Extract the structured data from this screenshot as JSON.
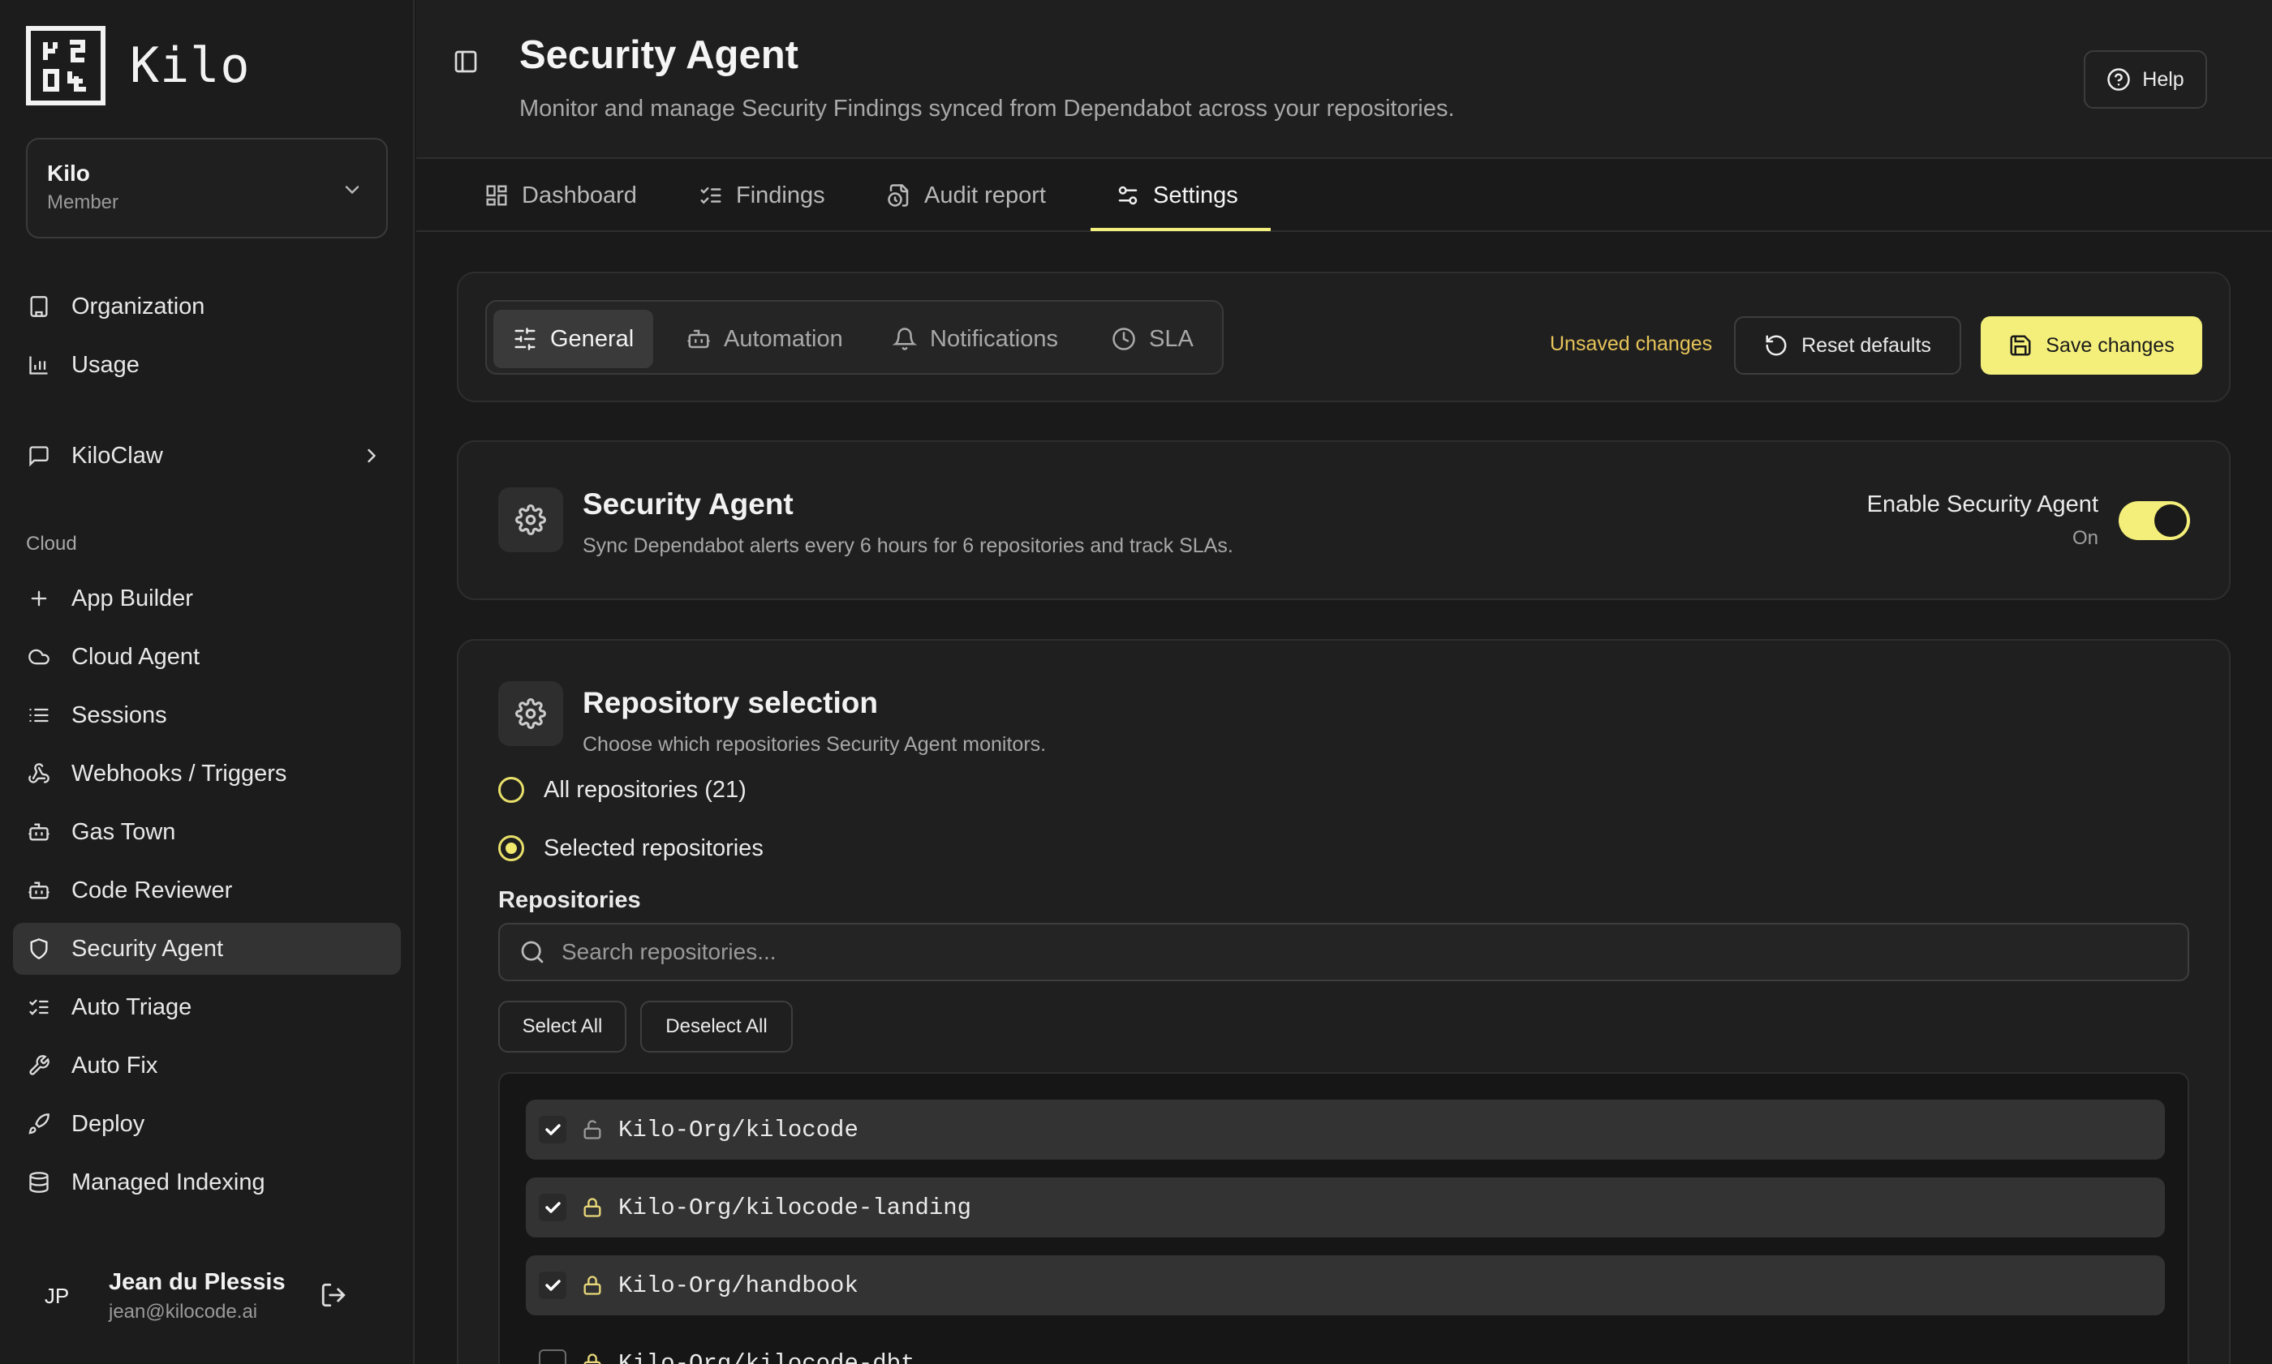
{
  "app": {
    "name": "Kilo"
  },
  "org_switcher": {
    "name": "Kilo",
    "role": "Member"
  },
  "nav": {
    "top_items": [
      {
        "label": "Organization",
        "icon": "building-icon"
      },
      {
        "label": "Usage",
        "icon": "bar-chart-icon"
      }
    ],
    "kiloclaw": {
      "label": "KiloClaw",
      "icon": "message-square-icon"
    },
    "section_label": "Cloud",
    "cloud_items": [
      {
        "label": "App Builder",
        "icon": "plus-icon"
      },
      {
        "label": "Cloud Agent",
        "icon": "cloud-icon"
      },
      {
        "label": "Sessions",
        "icon": "list-icon"
      },
      {
        "label": "Webhooks / Triggers",
        "icon": "webhook-icon"
      },
      {
        "label": "Gas Town",
        "icon": "bot-icon"
      },
      {
        "label": "Code Reviewer",
        "icon": "bot-icon"
      },
      {
        "label": "Security Agent",
        "icon": "shield-icon",
        "active": true
      },
      {
        "label": "Auto Triage",
        "icon": "list-checks-icon"
      },
      {
        "label": "Auto Fix",
        "icon": "wrench-icon"
      },
      {
        "label": "Deploy",
        "icon": "rocket-icon"
      },
      {
        "label": "Managed Indexing",
        "icon": "database-icon"
      }
    ]
  },
  "user": {
    "initials": "JP",
    "name": "Jean du Plessis",
    "email": "jean@kilocode.ai"
  },
  "header": {
    "title": "Security Agent",
    "subtitle": "Monitor and manage Security Findings synced from Dependabot across your repositories.",
    "help_label": "Help"
  },
  "tabs": [
    {
      "label": "Dashboard",
      "icon": "dashboard-icon"
    },
    {
      "label": "Findings",
      "icon": "list-checks-icon"
    },
    {
      "label": "Audit report",
      "icon": "file-clock-icon"
    },
    {
      "label": "Settings",
      "icon": "settings-sliders-icon",
      "active": true
    }
  ],
  "settings": {
    "subtabs": [
      {
        "label": "General",
        "icon": "sliders-icon",
        "active": true
      },
      {
        "label": "Automation",
        "icon": "bot-icon"
      },
      {
        "label": "Notifications",
        "icon": "bell-icon"
      },
      {
        "label": "SLA",
        "icon": "clock-icon"
      }
    ],
    "unsaved": "Unsaved changes",
    "reset_label": "Reset defaults",
    "save_label": "Save changes"
  },
  "agent_card": {
    "title": "Security Agent",
    "description": "Sync Dependabot alerts every 6 hours for 6 repositories and track SLAs.",
    "enable_label": "Enable Security Agent",
    "enable_status": "On",
    "enabled": true
  },
  "repo_card": {
    "title": "Repository selection",
    "description": "Choose which repositories Security Agent monitors.",
    "option_all": "All repositories (21)",
    "option_selected": "Selected repositories",
    "selected_option": "selected",
    "repos_label": "Repositories",
    "search_placeholder": "Search repositories...",
    "select_all": "Select All",
    "deselect_all": "Deselect All",
    "repos": [
      {
        "name": "Kilo-Org/kilocode",
        "checked": true,
        "private": false
      },
      {
        "name": "Kilo-Org/kilocode-landing",
        "checked": true,
        "private": true
      },
      {
        "name": "Kilo-Org/handbook",
        "checked": true,
        "private": true
      },
      {
        "name": "Kilo-Org/kilocode-dbt",
        "checked": false,
        "private": true
      }
    ]
  },
  "colors": {
    "accent": "#f4ef7a",
    "warning_text": "#e6c45a",
    "lock_private": "#e8d77a"
  }
}
